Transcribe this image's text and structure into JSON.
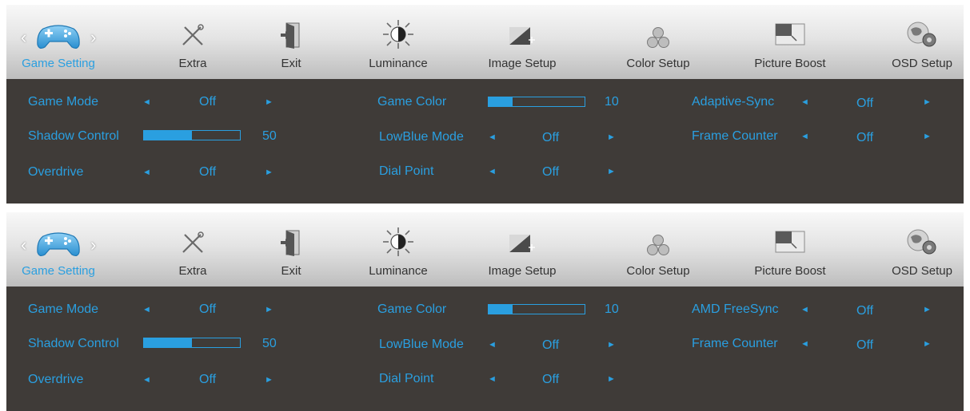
{
  "osd_panels": [
    {
      "tabs": {
        "game_setting": "Game Setting",
        "extra": "Extra",
        "exit": "Exit",
        "luminance": "Luminance",
        "image_setup": "Image Setup",
        "color_setup": "Color Setup",
        "picture_boost": "Picture Boost",
        "osd_setup": "OSD Setup"
      },
      "settings": {
        "game_mode": {
          "label": "Game Mode",
          "value": "Off"
        },
        "shadow_control": {
          "label": "Shadow Control",
          "value": "50",
          "level": 0.5
        },
        "overdrive": {
          "label": "Overdrive",
          "value": "Off"
        },
        "game_color": {
          "label": "Game Color",
          "value": "10",
          "level": 0.25
        },
        "lowblue_mode": {
          "label": "LowBlue Mode",
          "value": "Off"
        },
        "dial_point": {
          "label": "Dial Point",
          "value": "Off"
        },
        "sync": {
          "label": "Adaptive-Sync",
          "value": "Off"
        },
        "frame_counter": {
          "label": "Frame Counter",
          "value": "Off"
        }
      }
    },
    {
      "tabs": {
        "game_setting": "Game Setting",
        "extra": "Extra",
        "exit": "Exit",
        "luminance": "Luminance",
        "image_setup": "Image Setup",
        "color_setup": "Color Setup",
        "picture_boost": "Picture Boost",
        "osd_setup": "OSD Setup"
      },
      "settings": {
        "game_mode": {
          "label": "Game Mode",
          "value": "Off"
        },
        "shadow_control": {
          "label": "Shadow Control",
          "value": "50",
          "level": 0.5
        },
        "overdrive": {
          "label": "Overdrive",
          "value": "Off"
        },
        "game_color": {
          "label": "Game Color",
          "value": "10",
          "level": 0.25
        },
        "lowblue_mode": {
          "label": "LowBlue Mode",
          "value": "Off"
        },
        "dial_point": {
          "label": "Dial Point",
          "value": "Off"
        },
        "sync": {
          "label": "AMD FreeSync",
          "value": "Off"
        },
        "frame_counter": {
          "label": "Frame Counter",
          "value": "Off"
        }
      }
    }
  ],
  "colors": {
    "accent": "#2a9fe0",
    "panel_bg": "#3f3b38",
    "tab_text": "#333333"
  },
  "icons": [
    "gamepad-icon",
    "tools-icon",
    "exit-door-icon",
    "sun-icon",
    "image-setup-icon",
    "color-circles-icon",
    "picture-boost-icon",
    "osd-setup-icon"
  ]
}
